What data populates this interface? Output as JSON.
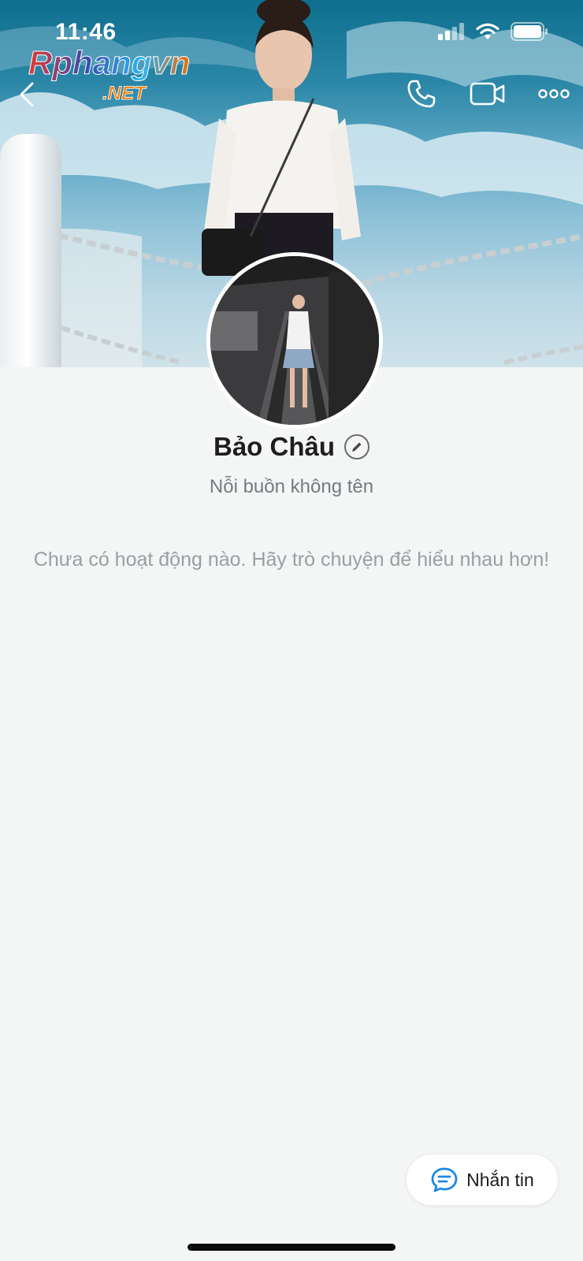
{
  "status_bar": {
    "time": "11:46"
  },
  "watermark": {
    "brand": "Rphangvn",
    "suffix": ".NET"
  },
  "top_nav": {
    "back_icon": "chevron-left-icon",
    "call_icon": "phone-icon",
    "video_icon": "video-camera-icon",
    "more_icon": "more-icon"
  },
  "profile": {
    "name": "Bảo Châu",
    "bio": "Nỗi buồn không tên",
    "empty_activity": "Chưa có hoạt động nào. Hãy trò chuyện để hiểu nhau hơn!"
  },
  "actions": {
    "message_label": "Nhắn tin",
    "message_icon": "chat-bubble-icon"
  },
  "colors": {
    "background": "#f4f5f5",
    "accent": "#1e88e5",
    "muted_text": "#9a9ea4"
  }
}
